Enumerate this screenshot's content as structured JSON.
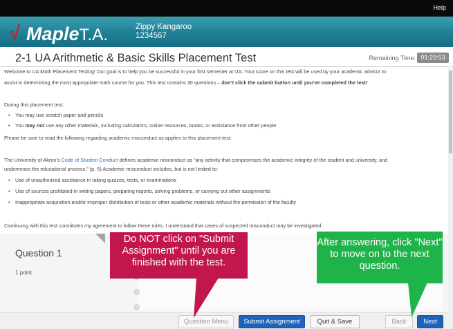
{
  "topbar": {
    "help": "Help"
  },
  "logo": {
    "check": "√",
    "word": "Maple",
    "ta": "T.A."
  },
  "user": {
    "name": "Zippy Kangaroo",
    "id": "1234567"
  },
  "test": {
    "title": "2-1 UA Arithmetic & Basic Skills Placement Test",
    "remaining_label": "Remaining Time:",
    "remaining_time": "01:29:53"
  },
  "intro": {
    "line1": "Welcome to UA Math Placement Testing!  Our goal is to help you be successful in your first semester at UA.  Your score on this test will be used by your academic advisor to",
    "line2_start": "assist in determining the most appropriate math course for you.  This test contains 30 questions – ",
    "line2_bold": "don’t click the submit button until you’ve completed the test!"
  },
  "during": {
    "heading": "During this placement test:",
    "bullet1": "You may use scratch paper and pencils",
    "bullet2_start": "You ",
    "bullet2_bold": "may not",
    "bullet2_end": " use any other materials, including calculators, online resources, books, or assistance from other people",
    "read_line": "Please be sure to read the following regarding academic misconduct as applies to this placement test:"
  },
  "conduct": {
    "line1_start": "The University of Akron’s ",
    "link": "Code of Student Conduct",
    "line1_end": " defines academic misconduct as “any activity that compromises the academic integrity of the student and university, and",
    "line2": "undermines the educational process.” (p. 5) Academic misconduct includes, but is not limited to:",
    "bullets": [
      "Use of unauthorized assistance in taking quizzes, tests, or examinations",
      "Use of sources prohibited in writing papers, preparing reports, solving problems, or carrying out other assignments",
      "Inappropriate acquisition and/or improper distribution of tests or other academic materials without the permission of the faculty"
    ],
    "continuing": "Continuing with this test constitutes my agreement to follow these rules. I understand that cases of suspected misconduct may be investigated."
  },
  "question": {
    "title": "Question 1",
    "points": "1 point"
  },
  "buttons": {
    "question_menu": "Question Menu",
    "submit": "Submit Assignment",
    "quit": "Quit & Save",
    "back": "Back",
    "next": "Next"
  },
  "callouts": {
    "red": "Do NOT click on \"Submit Assignment\" until you are finished with the test.",
    "green": "After answering, click \"Next\" to move on to the next question."
  },
  "colors": {
    "banner": "#1f7f95",
    "primary_button": "#1f63b8",
    "callout_red": "#c2174d",
    "callout_green": "#1fb44a",
    "link": "#2a6fb0"
  }
}
